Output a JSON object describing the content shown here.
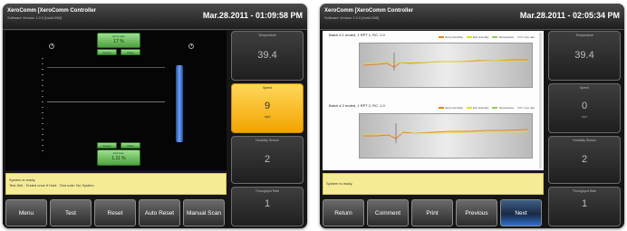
{
  "left": {
    "app_title": "XeroComm [XeroComm Controller",
    "version": "Software Version 1.0.0 [build 058]",
    "datetime": "Mar.28.2011 - 01:09:58 PM",
    "top_box": {
      "label": "Entry Gas",
      "value": "17 %",
      "left": "Sweep",
      "right": "Mode"
    },
    "bottom_box": {
      "label": "Exit Gas",
      "value": "1.11 %",
      "left": "Sweep",
      "right": "Mode"
    },
    "message": [
      "System is ready.",
      "Test Sell : Tested once if Hold . Test note: No System"
    ],
    "buttons": [
      "Menu",
      "Test",
      "Reset",
      "Auto Reset",
      "Manual Scan"
    ],
    "panels": [
      {
        "header": "Temperature",
        "value": "39.4",
        "unit": ""
      },
      {
        "header": "Speed",
        "value": "9",
        "unit": "mph"
      },
      {
        "header": "Humidity Sensor",
        "value": "2",
        "unit": ""
      },
      {
        "header": "Throughput Rate",
        "value": "1",
        "unit": ""
      }
    ]
  },
  "right": {
    "app_title": "XeroComm [XeroComm Controller",
    "version": "Software Version 1.0.0 [build 058]",
    "datetime": "Mar.28.2011 - 02:05:34 PM",
    "charts": [
      {
        "title": "Batch # 1 ended, 1 RPT 1, RC: 1.0"
      },
      {
        "title": "Batch # 2 ended, 1 RPT 2, RC: 1.0"
      }
    ],
    "legend": [
      {
        "name": "Entry Humidity",
        "color": "#e8841a"
      },
      {
        "name": "Exit Humidity",
        "color": "#dede3a"
      },
      {
        "name": "Temperature",
        "color": "#8dcf5a"
      },
      {
        "name": "Line rate",
        "color": "#cccccc"
      }
    ],
    "message": [
      "System is ready."
    ],
    "buttons": [
      "Return",
      "Comment",
      "Print",
      "Previous",
      "Next"
    ],
    "panels": [
      {
        "header": "Temperature",
        "value": "39.4",
        "unit": ""
      },
      {
        "header": "Speed",
        "value": "0",
        "unit": "mph"
      },
      {
        "header": "Humidity Sensor",
        "value": "2",
        "unit": ""
      },
      {
        "header": "Throughput Rate",
        "value": "1",
        "unit": ""
      }
    ]
  }
}
